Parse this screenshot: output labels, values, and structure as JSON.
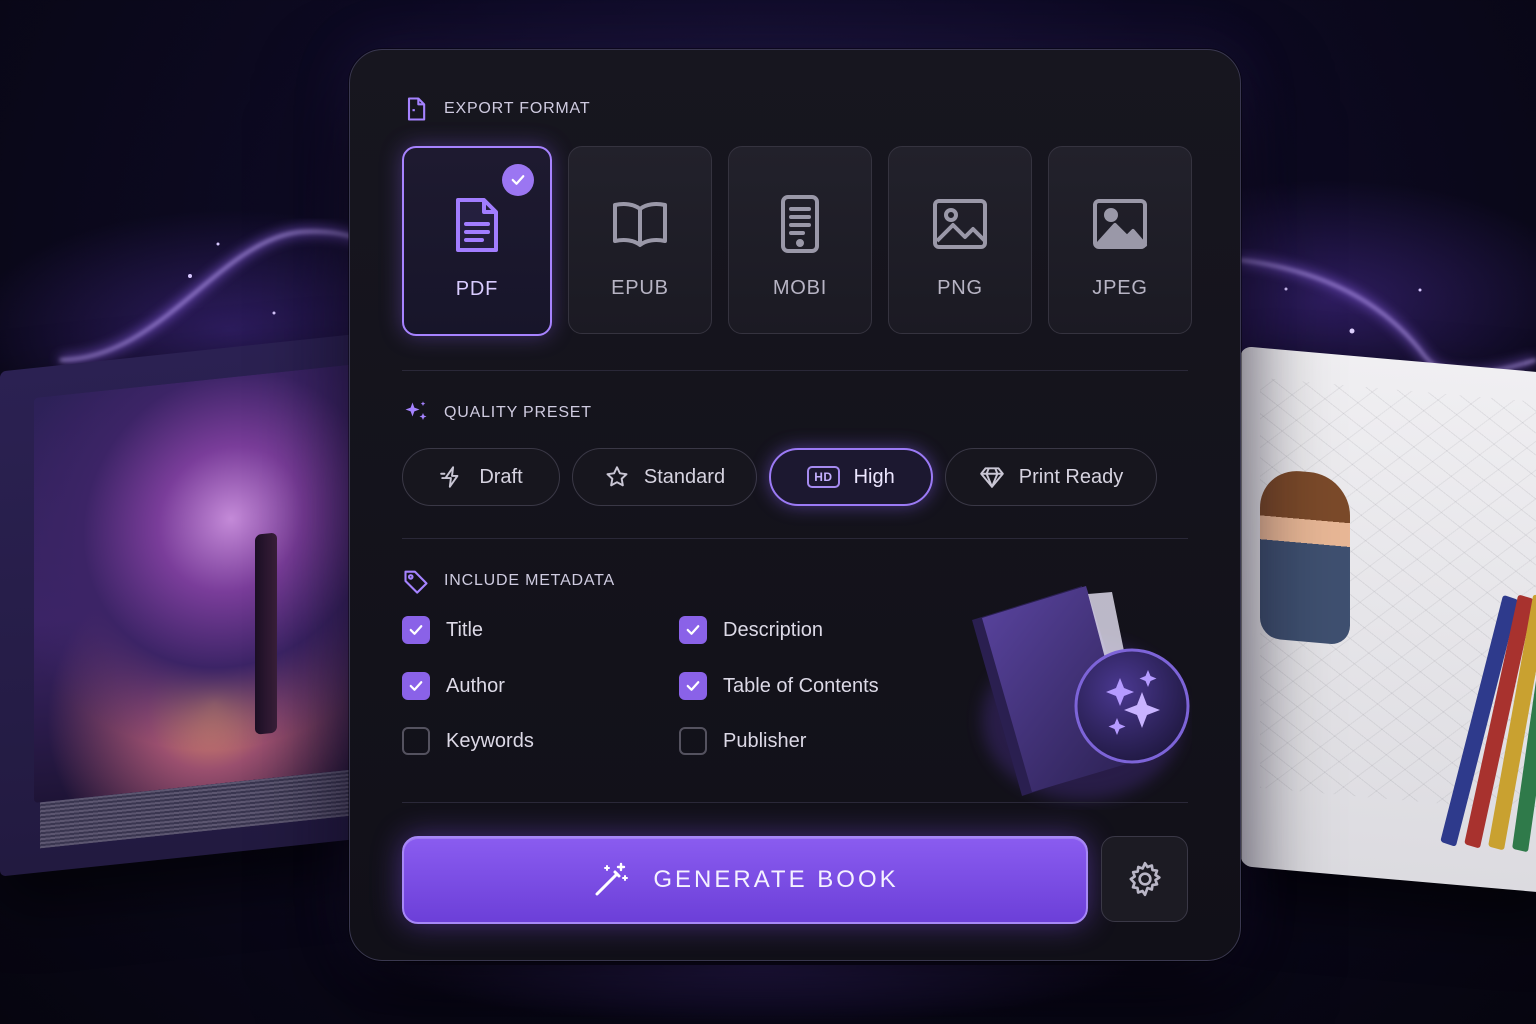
{
  "export_format": {
    "heading": "EXPORT FORMAT",
    "heading_icon": "file-icon",
    "selected": "PDF",
    "options": [
      {
        "label": "PDF",
        "icon": "document-icon",
        "selected": true
      },
      {
        "label": "EPUB",
        "icon": "open-book-icon",
        "selected": false
      },
      {
        "label": "MOBI",
        "icon": "ereader-icon",
        "selected": false
      },
      {
        "label": "PNG",
        "icon": "image-icon",
        "selected": false
      },
      {
        "label": "JPEG",
        "icon": "image-filled-icon",
        "selected": false
      }
    ]
  },
  "quality_preset": {
    "heading": "QUALITY PRESET",
    "heading_icon": "sparkles-icon",
    "selected": "High",
    "options": [
      {
        "label": "Draft",
        "icon": "lightning-icon",
        "active": false
      },
      {
        "label": "Standard",
        "icon": "star-icon",
        "active": false
      },
      {
        "label": "High",
        "icon": "hd-icon",
        "badge": "HD",
        "active": true
      },
      {
        "label": "Print Ready",
        "icon": "diamond-icon",
        "active": false
      }
    ]
  },
  "metadata": {
    "heading": "INCLUDE METADATA",
    "heading_icon": "tag-icon",
    "fields": [
      {
        "label": "Title",
        "checked": true
      },
      {
        "label": "Description",
        "checked": true
      },
      {
        "label": "Author",
        "checked": true
      },
      {
        "label": "Table of Contents",
        "checked": true
      },
      {
        "label": "Keywords",
        "checked": false
      },
      {
        "label": "Publisher",
        "checked": false
      }
    ]
  },
  "actions": {
    "generate_label": "GENERATE BOOK",
    "generate_icon": "magic-wand-icon",
    "settings_icon": "gear-icon"
  },
  "colors": {
    "accent": "#8a62e8",
    "accent_glow": "#a783ff",
    "panel_bg": "#15141c",
    "page_bg": "#0d0a22"
  }
}
